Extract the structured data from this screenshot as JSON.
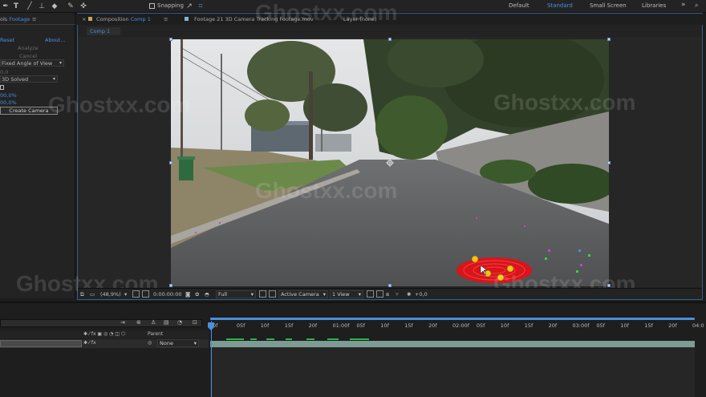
{
  "toolbar": {
    "snapping_label": "Snapping",
    "workspaces": [
      "Default",
      "Standard",
      "Small Screen",
      "Libraries"
    ],
    "active_workspace": "Standard",
    "overflow_label": "»"
  },
  "effect_panel": {
    "title_prefix": "ols",
    "title_layer": "Footage",
    "reset_label": "Reset",
    "about_label": "About...",
    "analyze_label": "Analyze",
    "cancel_label": "Cancel",
    "shot_type_value": "Fixed Angle of View",
    "value_0": "0,0",
    "solve_value": "3D Solved",
    "percent_1": "00,0%",
    "percent_2": "00,0%",
    "create_camera_label": "Create Camera"
  },
  "comp_panel": {
    "tab_comp_prefix": "Composition",
    "tab_comp_name": "Comp 1",
    "tab_footage": "Footage 21 3D Camera Tracking Footage.mov",
    "tab_layer": "Layer (none)",
    "crumb": "Comp 1"
  },
  "comp_footer": {
    "zoom": "(48,9%)",
    "timecode": "0:00:00:00",
    "resolution": "Full",
    "camera": "Active Camera",
    "views": "1 View",
    "exposure": "+0,0"
  },
  "timeline": {
    "parent_header": "Parent",
    "parent_value": "None",
    "ticks": [
      "0f",
      "05f",
      "10f",
      "15f",
      "20f",
      "01:00f",
      "05f",
      "10f",
      "15f",
      "20f",
      "02:00f",
      "05f",
      "10f",
      "15f",
      "20f",
      "03:00f",
      "05f",
      "10f",
      "15f",
      "20f",
      "04:0"
    ]
  },
  "watermark": "Ghostxx.com",
  "colors": {
    "accent": "#4a8fe0",
    "target": "#d9141b",
    "track_point": "#f2c218"
  }
}
